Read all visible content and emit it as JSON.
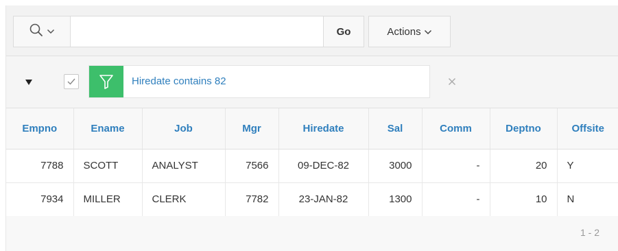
{
  "toolbar": {
    "search_icon": "search-icon",
    "search_value": "",
    "search_placeholder": "",
    "go_label": "Go",
    "actions_label": "Actions"
  },
  "filter": {
    "text": "Hiredate contains 82",
    "enabled": true,
    "accent_color": "#3dbf6b"
  },
  "table": {
    "columns": [
      "Empno",
      "Ename",
      "Job",
      "Mgr",
      "Hiredate",
      "Sal",
      "Comm",
      "Deptno",
      "Offsite"
    ],
    "rows": [
      [
        "7788",
        "SCOTT",
        "ANALYST",
        "7566",
        "09-DEC-82",
        "3000",
        "-",
        "20",
        "Y"
      ],
      [
        "7934",
        "MILLER",
        "CLERK",
        "7782",
        "23-JAN-82",
        "1300",
        "-",
        "10",
        "N"
      ]
    ]
  },
  "pagination": "1 - 2",
  "colors": {
    "header_text": "#2f7fbd",
    "link_text": "#2f7fbd"
  }
}
